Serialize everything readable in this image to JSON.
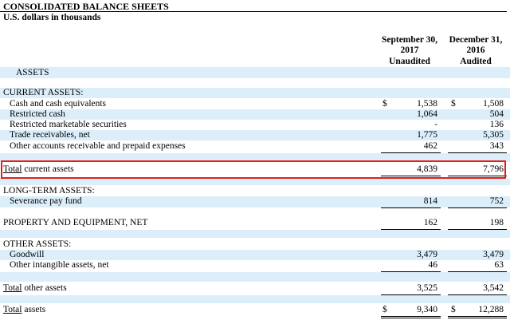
{
  "title": "CONSOLIDATED BALANCE SHEETS",
  "subtitle": "U.S. dollars in thousands",
  "columns": {
    "col1": {
      "line1": "September 30,",
      "line2": "2017",
      "line3": "Unaudited"
    },
    "col2": {
      "line1": "December 31,",
      "line2": "2016",
      "line3": "Audited"
    }
  },
  "assets_heading": "ASSETS",
  "current_assets": {
    "heading": "CURRENT ASSETS:",
    "rows": [
      {
        "label": "Cash and cash equivalents",
        "dollar1": "$",
        "v1": "1,538",
        "dollar2": "$",
        "v2": "1,508"
      },
      {
        "label": "Restricted cash",
        "v1": "1,064",
        "v2": "504"
      },
      {
        "label": "Restricted marketable securities",
        "v1": "-",
        "v2": "136"
      },
      {
        "label": "Trade receivables, net",
        "v1": "1,775",
        "v2": "5,305"
      },
      {
        "label": "Other accounts receivable and prepaid expenses",
        "v1": "462",
        "v2": "343"
      }
    ],
    "total": {
      "label_u": "Total",
      "label_rest": " current assets",
      "v1": "4,839",
      "v2": "7,796"
    }
  },
  "long_term": {
    "heading": "LONG-TERM ASSETS:",
    "row": {
      "label": "Severance pay fund",
      "v1": "814",
      "v2": "752"
    }
  },
  "ppe": {
    "label": "PROPERTY AND EQUIPMENT, NET",
    "v1": "162",
    "v2": "198"
  },
  "other_assets": {
    "heading": "OTHER ASSETS:",
    "rows": [
      {
        "label": "Goodwill",
        "v1": "3,479",
        "v2": "3,479"
      },
      {
        "label": "Other intangible assets, net",
        "v1": "46",
        "v2": "63"
      }
    ],
    "total": {
      "label_u": "Total",
      "label_rest": " other assets",
      "v1": "3,525",
      "v2": "3,542"
    }
  },
  "total_assets": {
    "label_u": "Total",
    "label_rest": " assets",
    "dollar1": "$",
    "v1": "9,340",
    "dollar2": "$",
    "v2": "12,288"
  },
  "colors": {
    "band": "#dbeefa",
    "highlight": "#e0201c"
  }
}
